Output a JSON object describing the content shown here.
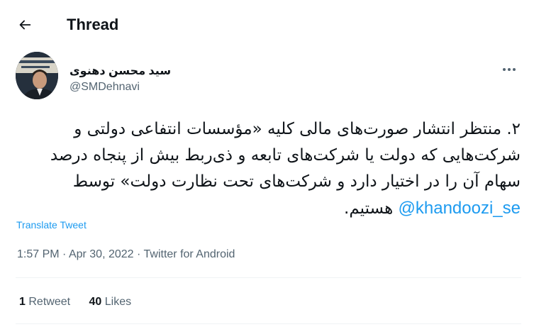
{
  "header": {
    "title": "Thread",
    "back_icon": "arrow-left-icon"
  },
  "tweet": {
    "author": {
      "display_name": "سید محسن دهنوی",
      "handle": "@SMDehnavi"
    },
    "more_icon": "more-horizontal-icon",
    "text_before_mention": "۲. منتظر انتشار صورت‌های مالی کلیه «مؤسسات انتفاعی دولتی و شرکت‌هایی که دولت یا شرکت‌های تابعه و ذی‌ربط بیش از پنجاه درصد سهام آن را در اختیار دارد و شرکت‌های تحت نظارت دولت» توسط",
    "mention": "@khandoozi_se",
    "text_after_mention": "هستیم.",
    "translate_label": "Translate Tweet",
    "time": "1:57 PM",
    "date": "Apr 30, 2022",
    "separator": "·",
    "source": "Twitter for Android"
  },
  "stats": {
    "retweets_count": "1",
    "retweets_label": "Retweet",
    "likes_count": "40",
    "likes_label": "Likes"
  },
  "colors": {
    "text_primary": "#0f1419",
    "text_secondary": "#536471",
    "link": "#1d9bf0",
    "divider": "#eff3f4"
  }
}
